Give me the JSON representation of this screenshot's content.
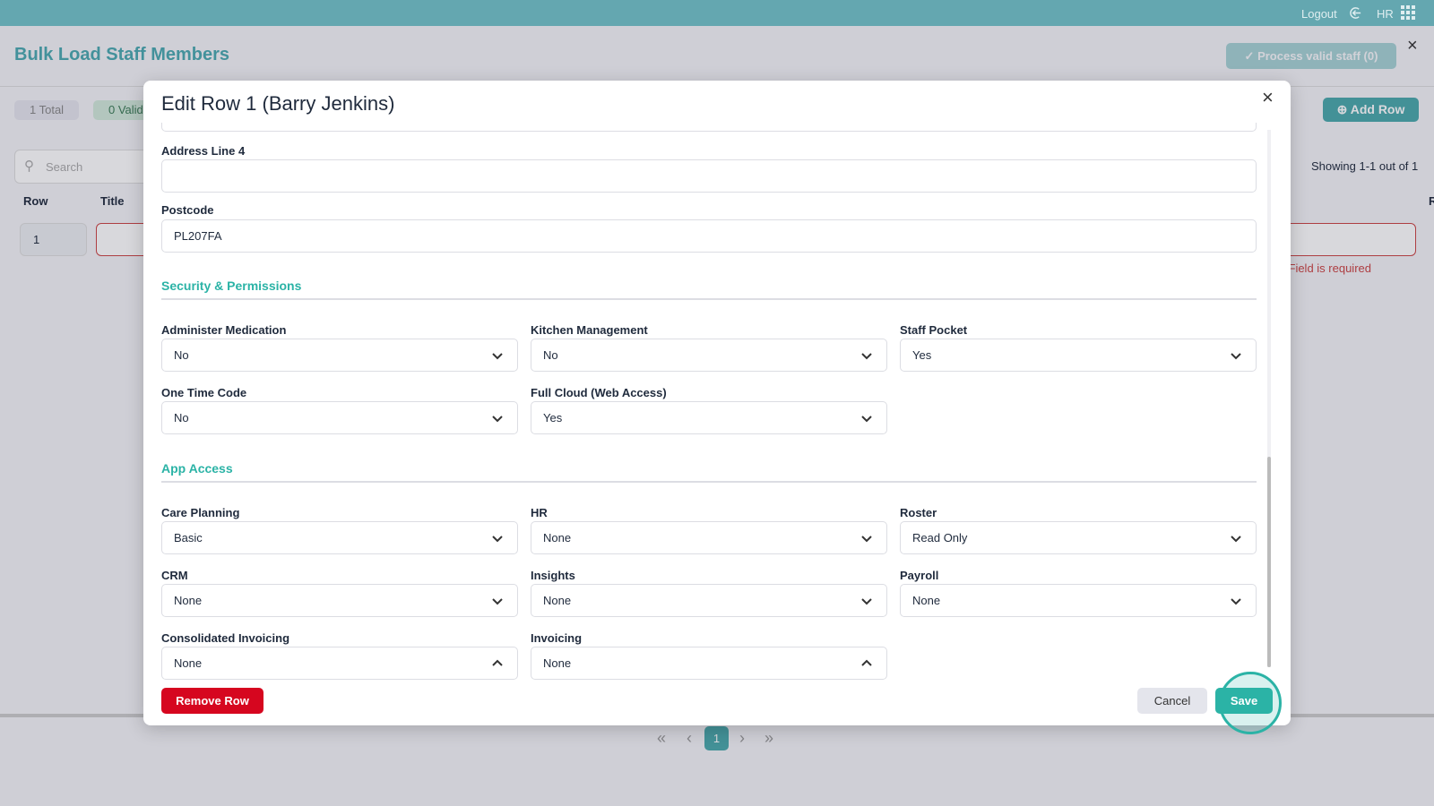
{
  "topbar": {
    "logout": "Logout",
    "user": "HR"
  },
  "page": {
    "title": "Bulk Load Staff Members",
    "process_button": "Process valid staff (0)",
    "total": "1 Total",
    "valid": "0 Valid",
    "add_row": "Add Row",
    "search_placeholder": "Search",
    "showing": "Showing 1-1 out of 1",
    "col_row": "Row",
    "col_title": "Title",
    "col_r": "R",
    "row_number": "1",
    "error": "Field is required",
    "page": "1"
  },
  "modal": {
    "title": "Edit Row 1 (Barry Jenkins)",
    "address4_label": "Address Line 4",
    "address4_value": "",
    "postcode_label": "Postcode",
    "postcode_value": "PL207FA",
    "security_heading": "Security & Permissions",
    "security": [
      {
        "label": "Administer Medication",
        "value": "No"
      },
      {
        "label": "Kitchen Management",
        "value": "No"
      },
      {
        "label": "Staff Pocket",
        "value": "Yes"
      },
      {
        "label": "One Time Code",
        "value": "No"
      },
      {
        "label": "Full Cloud (Web Access)",
        "value": "Yes"
      }
    ],
    "app_heading": "App Access",
    "apps": [
      {
        "label": "Care Planning",
        "value": "Basic"
      },
      {
        "label": "HR",
        "value": "None"
      },
      {
        "label": "Roster",
        "value": "Read Only"
      },
      {
        "label": "CRM",
        "value": "None"
      },
      {
        "label": "Insights",
        "value": "None"
      },
      {
        "label": "Payroll",
        "value": "None"
      },
      {
        "label": "Consolidated Invoicing",
        "value": "None"
      },
      {
        "label": "Invoicing",
        "value": "None"
      }
    ],
    "remove_row": "Remove Row",
    "cancel": "Cancel",
    "save": "Save"
  }
}
